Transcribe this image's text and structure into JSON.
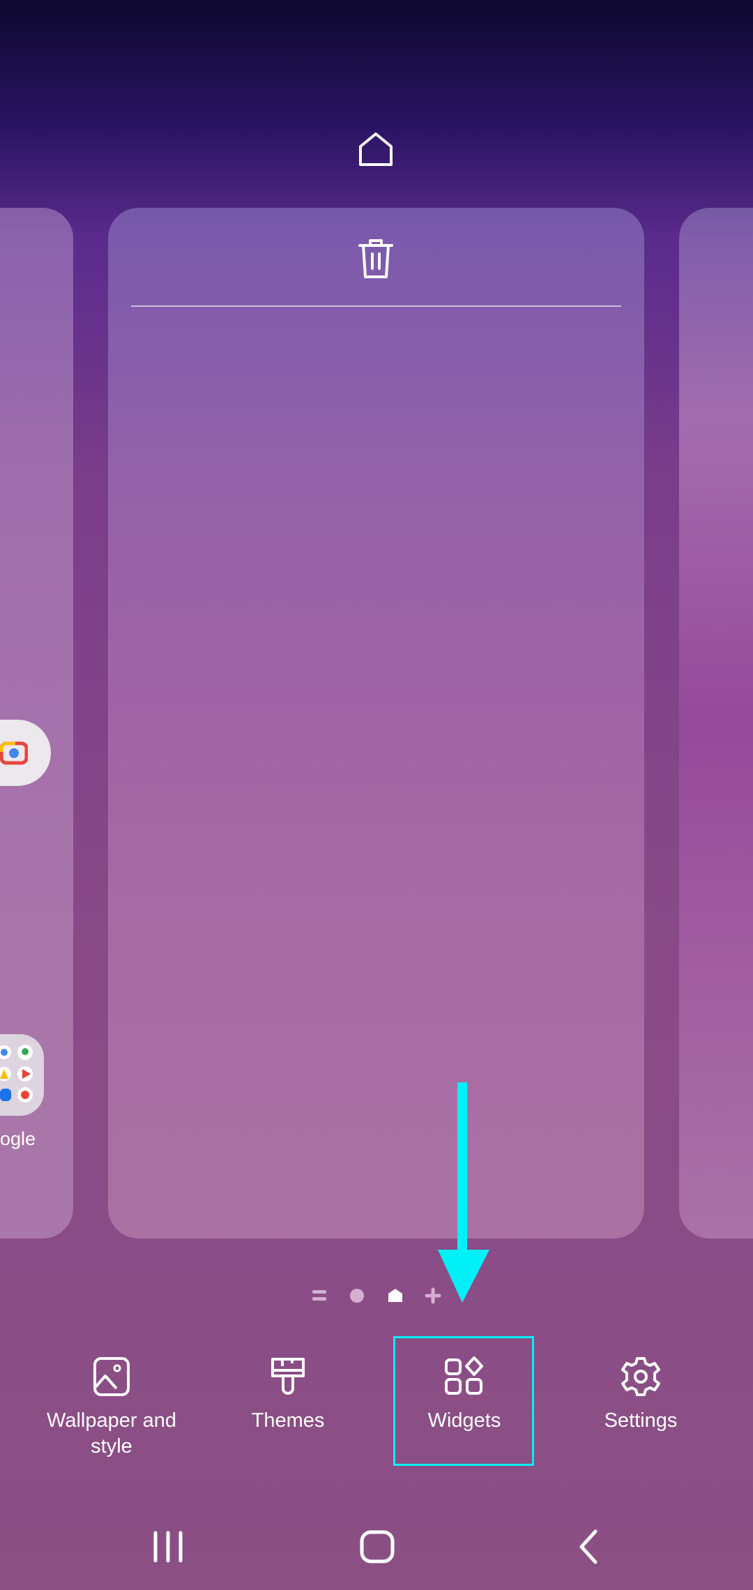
{
  "top": {
    "home_icon": "home-icon"
  },
  "card": {
    "delete_icon": "trash-icon"
  },
  "left_page": {
    "folder_label": "ogle"
  },
  "page_indicator": {
    "items": [
      "list",
      "dot",
      "home",
      "add"
    ],
    "current": "home"
  },
  "menu": {
    "items": [
      {
        "label": "Wallpaper and style",
        "icon": "image-icon"
      },
      {
        "label": "Themes",
        "icon": "paintbrush-icon"
      },
      {
        "label": "Widgets",
        "icon": "widgets-icon"
      },
      {
        "label": "Settings",
        "icon": "gear-icon"
      }
    ]
  },
  "annotation": {
    "color": "#00f0f8",
    "target": "Widgets"
  },
  "navbar": {
    "items": [
      "recents",
      "home",
      "back"
    ]
  }
}
